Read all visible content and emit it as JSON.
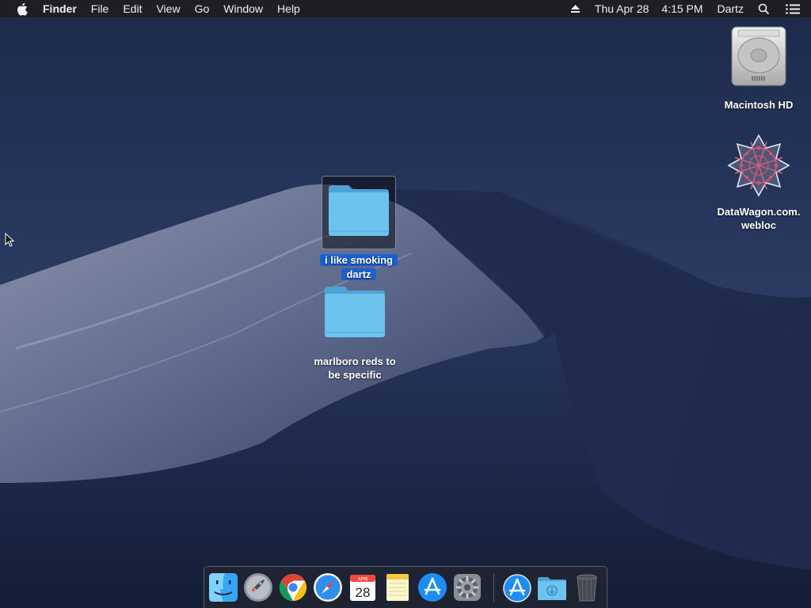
{
  "menubar": {
    "apple_icon": "apple-logo-icon",
    "app_name": "Finder",
    "menus": [
      "File",
      "Edit",
      "View",
      "Go",
      "Window"
    ],
    "help": "Help",
    "date": "Thu Apr 28",
    "time": "4:15 PM",
    "user": "Dartz",
    "right_icons": [
      "eject-icon",
      "spotlight-search-icon",
      "notification-center-icon"
    ]
  },
  "desktop_icons": {
    "macintosh_hd": "Macintosh HD",
    "datawagon_line1": "DataWagon.com.",
    "datawagon_line2": "webloc",
    "folder1_line1": "i like smoking",
    "folder1_line2": "dartz",
    "folder2_line1": "marlboro reds to",
    "folder2_line2": "be specific"
  },
  "calendar": {
    "month": "APR",
    "day": "28"
  },
  "dock_apps": [
    "finder",
    "launchpad",
    "chrome",
    "safari",
    "calendar",
    "notes",
    "app-store",
    "system-preferences",
    "app-store-downloads",
    "downloads-folder",
    "trash"
  ],
  "colors": {
    "selection": "#1d5fd0",
    "folder": "#6cc4ee"
  }
}
